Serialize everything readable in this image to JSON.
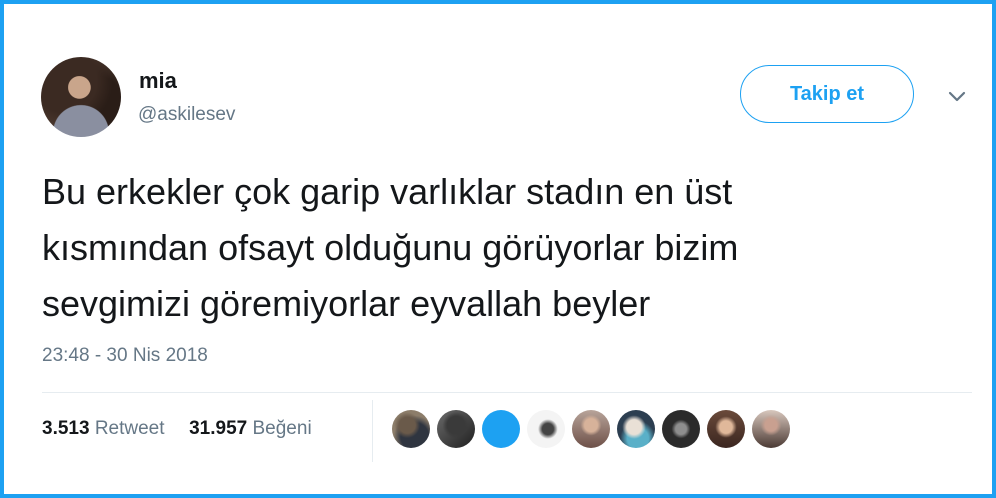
{
  "user": {
    "name": "mia",
    "handle": "@askilesev"
  },
  "header": {
    "follow_label": "Takip et",
    "menu_icon": "chevron-down-icon"
  },
  "tweet": {
    "lines": [
      "Bu erkekler çok garip varlıklar stadın en üst",
      "kısmından ofsayt olduğunu görüyorlar bizim",
      "sevgimizi göremiyorlar eyvallah beyler"
    ],
    "timestamp": "23:48 - 30 Nis 2018"
  },
  "stats": {
    "retweet_count": "3.513",
    "retweet_label": "Retweet",
    "like_count": "31.957",
    "like_label": "Beğeni"
  },
  "likers": {
    "count_shown": 9
  },
  "colors": {
    "accent": "#1da1f2",
    "text_primary": "#14171a",
    "text_secondary": "#657786",
    "divider": "#e6ecf0"
  }
}
